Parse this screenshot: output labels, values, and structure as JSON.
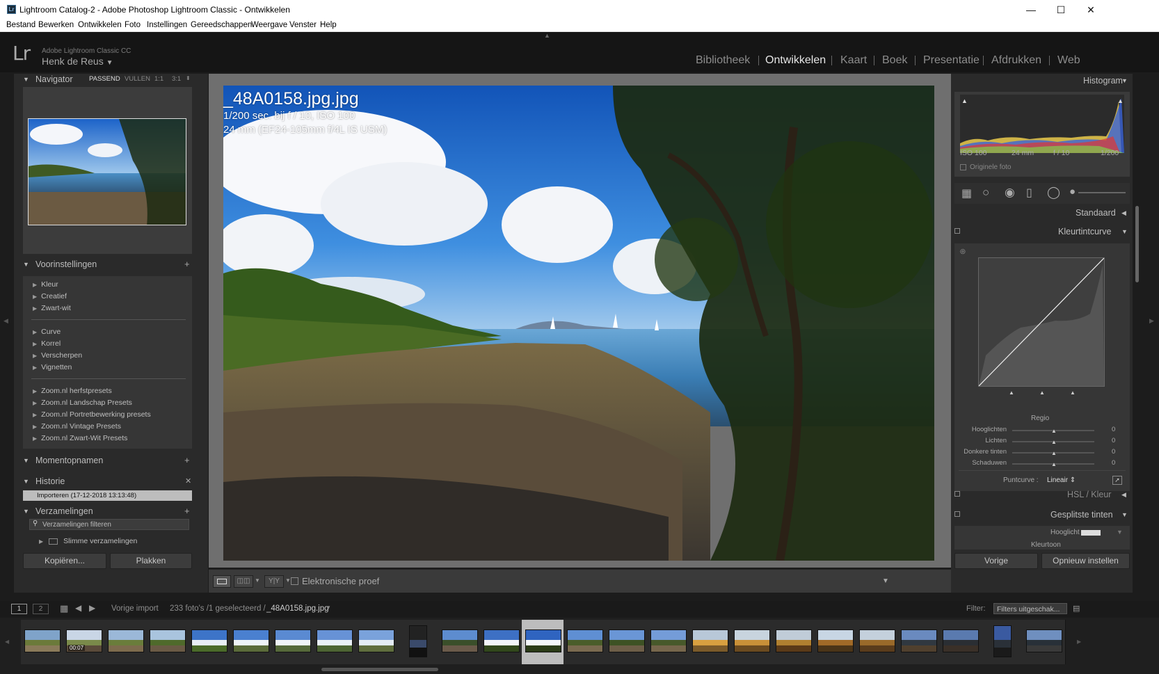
{
  "window": {
    "title": "Lightroom Catalog-2 - Adobe Photoshop Lightroom Classic - Ontwikkelen",
    "app_icon": "Lr",
    "minimize_icon": "minimize-icon",
    "maximize_icon": "maximize-icon",
    "close_icon": "close-icon"
  },
  "menu": [
    "Bestand",
    "Bewerken",
    "Ontwikkelen",
    "Foto",
    "Instellingen",
    "Gereedschappen",
    "Weergave",
    "Venster",
    "Help"
  ],
  "identity": {
    "logo": "Lr",
    "product": "Adobe Lightroom Classic CC",
    "user": "Henk de Reus"
  },
  "modules": [
    "Bibliotheek",
    "Ontwikkelen",
    "Kaart",
    "Boek",
    "Presentatie",
    "Afdrukken",
    "Web"
  ],
  "active_module": "Ontwikkelen",
  "navigator": {
    "title": "Navigator",
    "zoom_options": [
      "PASSEND",
      "VULLEN",
      "1:1",
      "3:1"
    ],
    "active_zoom": "PASSEND"
  },
  "presets": {
    "title": "Voorinstellingen",
    "groups": [
      [
        "Kleur",
        "Creatief",
        "Zwart-wit"
      ],
      [
        "Curve",
        "Korrel",
        "Verscherpen",
        "Vignetten"
      ],
      [
        "Zoom.nl herfstpresets",
        "Zoom.nl Landschap Presets",
        "Zoom.nl Portretbewerking presets",
        "Zoom.nl Vintage Presets",
        "Zoom.nl Zwart-Wit Presets"
      ]
    ]
  },
  "snapshots": {
    "title": "Momentopnamen"
  },
  "history": {
    "title": "Historie",
    "items": [
      "Importeren (17-12-2018 13:13:48)"
    ]
  },
  "collections": {
    "title": "Verzamelingen",
    "filter_placeholder": "Verzamelingen filteren",
    "items": [
      "Slimme verzamelingen"
    ]
  },
  "left_buttons": {
    "copy": "Kopiëren...",
    "paste": "Plakken"
  },
  "photo": {
    "filename": "_48A0158.jpg.jpg",
    "exposure": "1/200 sec. bij f / 10, ISO 100",
    "lens": "24 mm (EF24-105mm f/4L IS USM)"
  },
  "toolbar": {
    "soft_proof": "Elektronische proef"
  },
  "histogram": {
    "title": "Histogram",
    "iso": "ISO 100",
    "focal": "24 mm",
    "aperture": "f / 10",
    "shutter": "1/200",
    "original_photo": "Originele foto"
  },
  "right_sections": {
    "standard": "Standaard",
    "tone_curve": "Kleurtintcurve",
    "region": "Regio",
    "sliders": [
      {
        "label": "Hooglichten",
        "value": "0"
      },
      {
        "label": "Lichten",
        "value": "0"
      },
      {
        "label": "Donkere tinten",
        "value": "0"
      },
      {
        "label": "Schaduwen",
        "value": "0"
      }
    ],
    "point_curve_label": "Puntcurve :",
    "point_curve_value": "Lineair",
    "hsl": "HSL / Kleur",
    "split_toning": "Gesplitste tinten",
    "highlights": "Hooglicht",
    "hue": "Kleurtoon"
  },
  "right_buttons": {
    "previous": "Vorige",
    "reset": "Opnieuw instellen"
  },
  "filmstrip": {
    "screen1": "1",
    "screen2": "2",
    "source": "Vorige import",
    "count": "233 foto's /1 geselecteerd /",
    "selected_file": "_48A0158.jpg.jpg",
    "filter_label": "Filter:",
    "filter_value": "Filters uitgeschak...",
    "selected_index": 12,
    "video_badge": "00:07"
  },
  "colors": {
    "accent_text": "#e6e6e6",
    "panel_bg": "#2a2a2a",
    "center_bg": "#6f6f6f"
  }
}
